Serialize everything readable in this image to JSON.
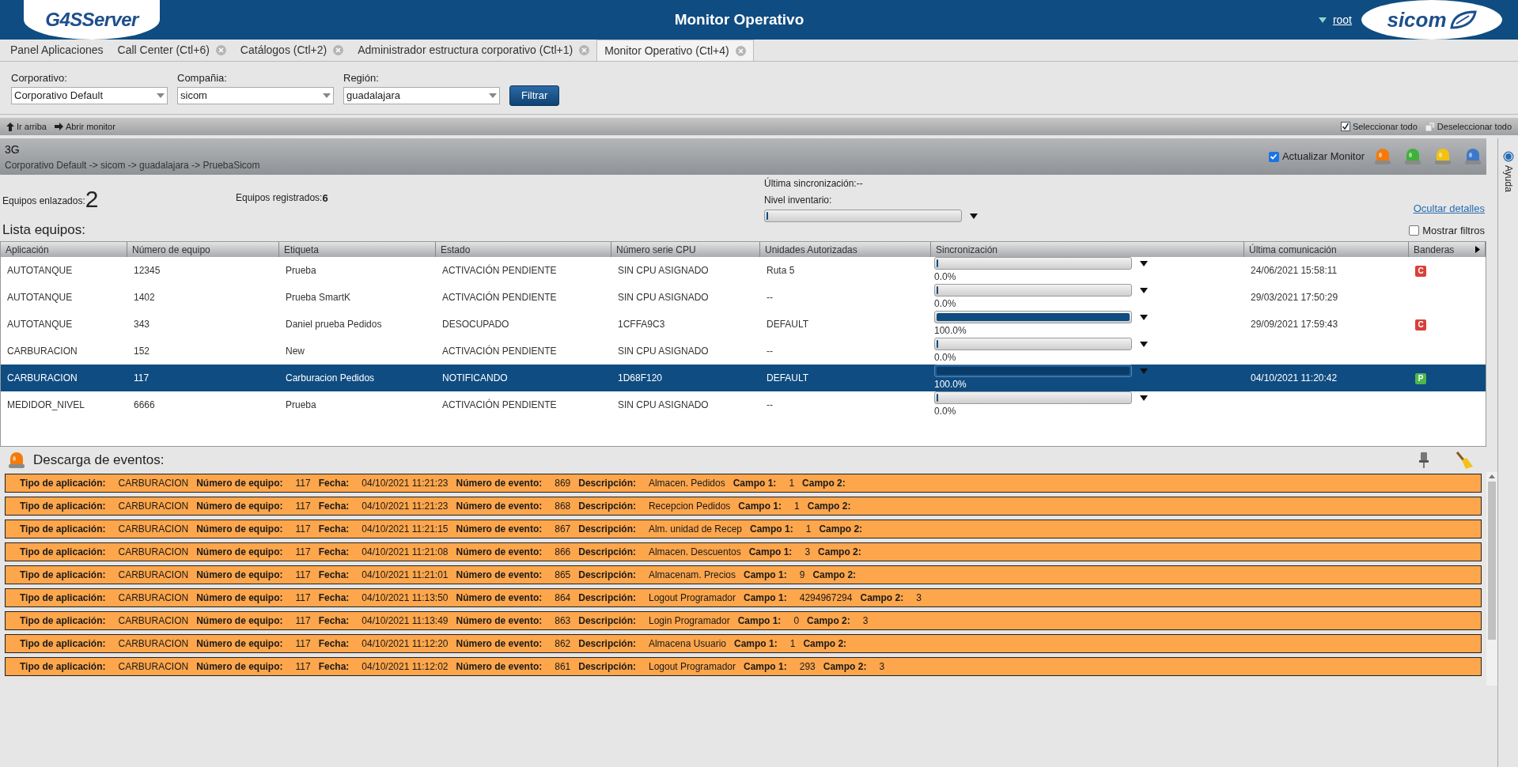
{
  "header": {
    "logo_left": "G4SServer",
    "title": "Monitor Operativo",
    "user": "root",
    "logo_right": "sicom"
  },
  "tabs": [
    {
      "label": "Panel Aplicaciones",
      "closable": false,
      "selected": false
    },
    {
      "label": "Call Center (Ctl+6)",
      "closable": true,
      "selected": false
    },
    {
      "label": "Catálogos (Ctl+2)",
      "closable": true,
      "selected": false
    },
    {
      "label": "Administrador estructura corporativo (Ctl+1)",
      "closable": true,
      "selected": false
    },
    {
      "label": "Monitor Operativo (Ctl+4)",
      "closable": true,
      "selected": true
    }
  ],
  "filters": [
    {
      "label": "Corporativo:",
      "value": "Corporativo Default"
    },
    {
      "label": "Compañia:",
      "value": "sicom"
    },
    {
      "label": "Región:",
      "value": "guadalajara"
    }
  ],
  "filter_button": "Filtrar",
  "toolbar": {
    "left": [
      "Ir arriba",
      "Abrir monitor"
    ],
    "select_all": "Seleccionar todo",
    "deselect_all": "Deseleccionar todo"
  },
  "monitor": {
    "name": "3G",
    "path": "Corporativo Default -> sicom -> guadalajara -> PruebaSicom",
    "auto_update": {
      "label": "Actualizar Monitor",
      "checked": true
    },
    "beacons": [
      {
        "color": "#f47a0c"
      },
      {
        "color": "#3fb13a"
      },
      {
        "color": "#f2c20f"
      },
      {
        "color": "#3e78c8"
      }
    ]
  },
  "help": "Ayuda",
  "info": {
    "linked_label": "Equipos enlazados:",
    "linked": "2",
    "registered_label": "Equipos registrados:",
    "registered": "6",
    "last_sync_label": "Última sincronización:",
    "last_sync": "--",
    "inventory_label": "Nivel inventario:",
    "inventory": {
      "level": 0
    },
    "hide_details": "Ocultar detalles",
    "show_filters": {
      "label": "Mostrar filtros",
      "checked": false
    }
  },
  "table": {
    "title": "Lista equipos:",
    "columns": [
      "Aplicación",
      "Número de equipo",
      "Etiqueta",
      "Estado",
      "Número serie CPU",
      "Unidades Autorizadas",
      "Sincronización",
      "Última comunicación",
      "Banderas"
    ],
    "rows": [
      {
        "cells": [
          "AUTOTANQUE",
          "12345",
          "Prueba",
          "ACTIVACIÓN PENDIENTE",
          "SIN CPU ASIGNADO",
          "Ruta 5"
        ],
        "sync": {
          "level": 0,
          "reading": "0.0%"
        },
        "last": "24/06/2021 15:58:11",
        "flag": {
          "letter": "C",
          "color": "#d9403a"
        },
        "selected": false
      },
      {
        "cells": [
          "AUTOTANQUE",
          "1402",
          "Prueba SmartK",
          "ACTIVACIÓN PENDIENTE",
          "SIN CPU ASIGNADO",
          "--"
        ],
        "sync": {
          "level": 0,
          "reading": "0.0%"
        },
        "last": "29/03/2021 17:50:29",
        "selected": false
      },
      {
        "cells": [
          "AUTOTANQUE",
          "343",
          "Daniel prueba Pedidos",
          "DESOCUPADO",
          "1CFFA9C3",
          "DEFAULT"
        ],
        "sync": {
          "level": 1,
          "reading": "100.0%"
        },
        "last": "29/09/2021 17:59:43",
        "flag": {
          "letter": "C",
          "color": "#d9403a"
        },
        "selected": false
      },
      {
        "cells": [
          "CARBURACION",
          "152",
          "New",
          "ACTIVACIÓN PENDIENTE",
          "SIN CPU ASIGNADO",
          "--"
        ],
        "sync": {
          "level": 0,
          "reading": "0.0%"
        },
        "selected": false
      },
      {
        "cells": [
          "CARBURACION",
          "117",
          "Carburacion Pedidos",
          "NOTIFICANDO",
          "1D68F120",
          "DEFAULT"
        ],
        "sync": {
          "level": 1,
          "reading": "100.0%"
        },
        "last": "04/10/2021 11:20:42",
        "flag": {
          "letter": "P",
          "color": "#4cb84c"
        },
        "selected": true
      },
      {
        "cells": [
          "MEDIDOR_NIVEL",
          "6666",
          "Prueba",
          "ACTIVACIÓN PENDIENTE",
          "SIN CPU ASIGNADO",
          "--"
        ],
        "sync": {
          "level": 0,
          "reading": "0.0%"
        },
        "selected": false
      }
    ]
  },
  "events": {
    "title": "Descarga de eventos:",
    "rows": [
      [
        [
          "Tipo de aplicación:",
          "CARBURACION"
        ],
        [
          "Número de equipo:",
          "117"
        ],
        [
          "Fecha:",
          "04/10/2021 11:21:23"
        ],
        [
          "Número de evento:",
          "869"
        ],
        [
          "Descripción:",
          "Almacen. Pedidos"
        ],
        [
          "Campo 1:",
          "1"
        ],
        [
          "Campo 2:"
        ]
      ],
      [
        [
          "Tipo de aplicación:",
          "CARBURACION"
        ],
        [
          "Número de equipo:",
          "117"
        ],
        [
          "Fecha:",
          "04/10/2021 11:21:23"
        ],
        [
          "Número de evento:",
          "868"
        ],
        [
          "Descripción:",
          "Recepcion Pedidos"
        ],
        [
          "Campo 1:",
          "1"
        ],
        [
          "Campo 2:"
        ]
      ],
      [
        [
          "Tipo de aplicación:",
          "CARBURACION"
        ],
        [
          "Número de equipo:",
          "117"
        ],
        [
          "Fecha:",
          "04/10/2021 11:21:15"
        ],
        [
          "Número de evento:",
          "867"
        ],
        [
          "Descripción:",
          "Alm. unidad de Recep"
        ],
        [
          "Campo 1:",
          "1"
        ],
        [
          "Campo 2:"
        ]
      ],
      [
        [
          "Tipo de aplicación:",
          "CARBURACION"
        ],
        [
          "Número de equipo:",
          "117"
        ],
        [
          "Fecha:",
          "04/10/2021 11:21:08"
        ],
        [
          "Número de evento:",
          "866"
        ],
        [
          "Descripción:",
          "Almacen. Descuentos"
        ],
        [
          "Campo 1:",
          "3"
        ],
        [
          "Campo 2:"
        ]
      ],
      [
        [
          "Tipo de aplicación:",
          "CARBURACION"
        ],
        [
          "Número de equipo:",
          "117"
        ],
        [
          "Fecha:",
          "04/10/2021 11:21:01"
        ],
        [
          "Número de evento:",
          "865"
        ],
        [
          "Descripción:",
          "Almacenam. Precios"
        ],
        [
          "Campo 1:",
          "9"
        ],
        [
          "Campo 2:"
        ]
      ],
      [
        [
          "Tipo de aplicación:",
          "CARBURACION"
        ],
        [
          "Número de equipo:",
          "117"
        ],
        [
          "Fecha:",
          "04/10/2021 11:13:50"
        ],
        [
          "Número de evento:",
          "864"
        ],
        [
          "Descripción:",
          "Logout Programador"
        ],
        [
          "Campo 1:",
          "4294967294"
        ],
        [
          "Campo 2:",
          "3"
        ]
      ],
      [
        [
          "Tipo de aplicación:",
          "CARBURACION"
        ],
        [
          "Número de equipo:",
          "117"
        ],
        [
          "Fecha:",
          "04/10/2021 11:13:49"
        ],
        [
          "Número de evento:",
          "863"
        ],
        [
          "Descripción:",
          "Login Programador"
        ],
        [
          "Campo 1:",
          "0"
        ],
        [
          "Campo 2:",
          "3"
        ]
      ],
      [
        [
          "Tipo de aplicación:",
          "CARBURACION"
        ],
        [
          "Número de equipo:",
          "117"
        ],
        [
          "Fecha:",
          "04/10/2021 11:12:20"
        ],
        [
          "Número de evento:",
          "862"
        ],
        [
          "Descripción:",
          "Almacena Usuario"
        ],
        [
          "Campo 1:",
          "1"
        ],
        [
          "Campo 2:"
        ]
      ],
      [
        [
          "Tipo de aplicación:",
          "CARBURACION"
        ],
        [
          "Número de equipo:",
          "117"
        ],
        [
          "Fecha:",
          "04/10/2021 11:12:02"
        ],
        [
          "Número de evento:",
          "861"
        ],
        [
          "Descripción:",
          "Logout Programador"
        ],
        [
          "Campo 1:",
          "293"
        ],
        [
          "Campo 2:",
          "3"
        ]
      ]
    ]
  }
}
